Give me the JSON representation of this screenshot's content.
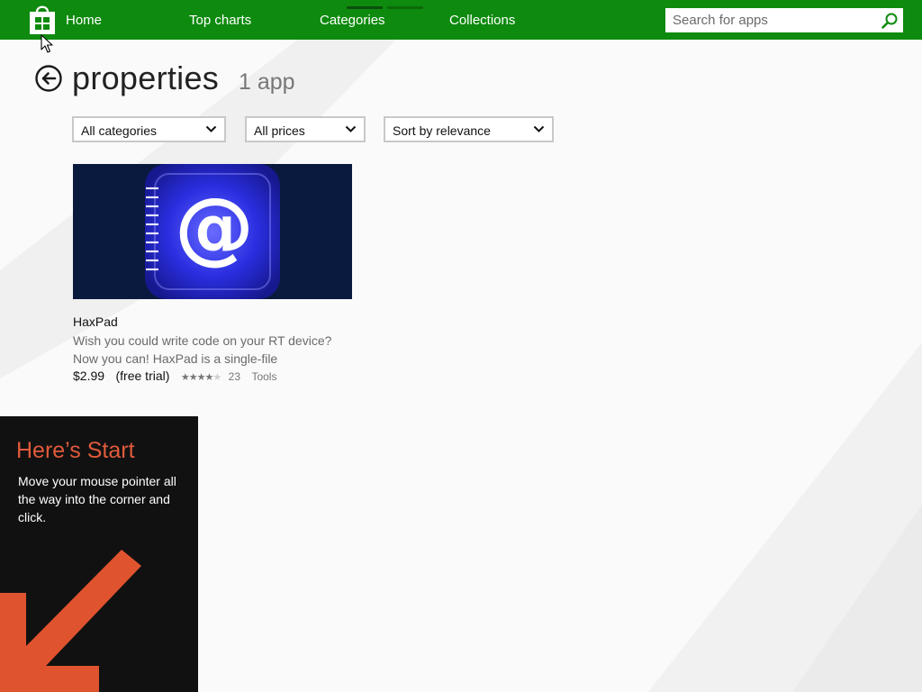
{
  "nav": {
    "home": "Home",
    "top_charts": "Top charts",
    "categories": "Categories",
    "collections": "Collections",
    "search_placeholder": "Search for apps"
  },
  "page": {
    "title": "properties",
    "count": "1 app"
  },
  "filters": {
    "category": "All categories",
    "price": "All prices",
    "sort": "Sort by relevance"
  },
  "app": {
    "name": "HaxPad",
    "description": "Wish you could write code on your RT device? Now you can! HaxPad is a single-file",
    "price": "$2.99",
    "trial": "(free trial)",
    "stars_filled": "★★★★",
    "stars_empty": "★",
    "rating_count": "23",
    "category": "Tools",
    "icon": "at-sign-notepad-icon"
  },
  "start_tip": {
    "title": "Here’s Start",
    "body": "Move your mouse pointer all the way into the corner and click."
  },
  "colors": {
    "accent": "#0e8a0e",
    "tip_background": "#111111",
    "tip_title": "#e05a3c",
    "tip_arrow": "#e0532f"
  }
}
